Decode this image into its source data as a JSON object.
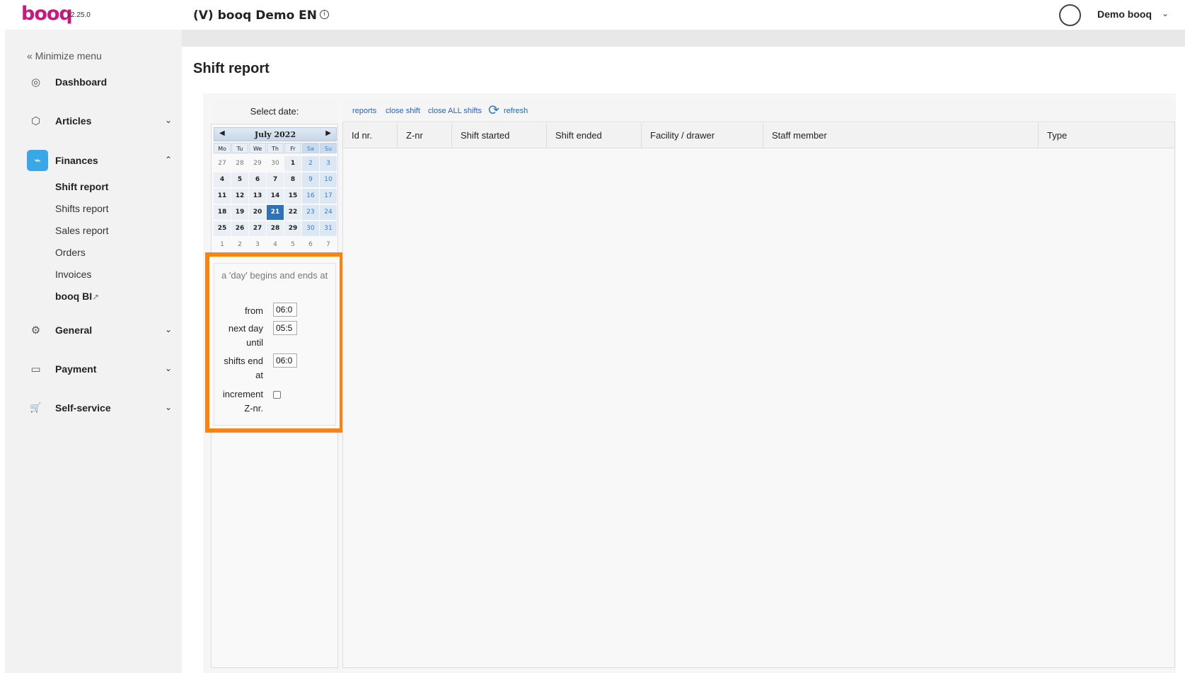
{
  "header": {
    "logo": "booq",
    "version": "v2.25.0",
    "app_title": "(V) booq Demo EN",
    "info_icon": "i",
    "user_name": "Demo booq",
    "user_chevron": "⌄"
  },
  "sidebar": {
    "minimize_label": "« Minimize menu",
    "items": [
      {
        "label": "Dashboard",
        "icon": "compass-icon",
        "glyph": "◎",
        "chevron": ""
      },
      {
        "label": "Articles",
        "icon": "box-icon",
        "glyph": "⬡",
        "chevron": "⌄"
      },
      {
        "label": "Finances",
        "icon": "pulse-icon",
        "glyph": "⌁",
        "chevron": "⌃"
      },
      {
        "label": "General",
        "icon": "gear-icon",
        "glyph": "⚙",
        "chevron": "⌄"
      },
      {
        "label": "Payment",
        "icon": "card-icon",
        "glyph": "▭",
        "chevron": "⌄"
      },
      {
        "label": "Self-service",
        "icon": "cart-icon",
        "glyph": "🛒",
        "chevron": "⌄"
      }
    ],
    "finances_sub": [
      "Shift report",
      "Shifts report",
      "Sales report",
      "Orders",
      "Invoices",
      "booq BI"
    ],
    "external_link_icon": "↗"
  },
  "page": {
    "title": "Shift report"
  },
  "calendar": {
    "select_label": "Select date:",
    "month": "July 2022",
    "prev": "◀",
    "next": "▶",
    "weekdays": [
      "Mo",
      "Tu",
      "We",
      "Th",
      "Fr",
      "Sa",
      "Su"
    ],
    "weeks": [
      [
        "27",
        "28",
        "29",
        "30",
        "1",
        "2",
        "3"
      ],
      [
        "4",
        "5",
        "6",
        "7",
        "8",
        "9",
        "10"
      ],
      [
        "11",
        "12",
        "13",
        "14",
        "15",
        "16",
        "17"
      ],
      [
        "18",
        "19",
        "20",
        "21",
        "22",
        "23",
        "24"
      ],
      [
        "25",
        "26",
        "27",
        "28",
        "29",
        "30",
        "31"
      ],
      [
        "1",
        "2",
        "3",
        "4",
        "5",
        "6",
        "7"
      ]
    ],
    "selected": "21"
  },
  "day_settings": {
    "title": "a 'day' begins and ends at",
    "from_label": "from",
    "from_value": "06:0",
    "next_day_label": "next day until",
    "next_day_value": "05:5",
    "shifts_end_label": "shifts end at",
    "shifts_end_value": "06:0",
    "increment_label": "increment Z-nr.",
    "increment_checked": false
  },
  "toolbar": {
    "reports": "reports",
    "close_shift": "close shift",
    "close_all": "close ALL shifts",
    "refresh_icon": "⟳",
    "refresh": "refresh"
  },
  "table": {
    "columns": [
      "Id nr.",
      "Z-nr",
      "Shift started",
      "Shift ended",
      "Facility / drawer",
      "Staff member",
      "Type"
    ]
  },
  "colors": {
    "brand": "#c9177e",
    "accent": "#3aa7e6",
    "highlight_border": "#f7850f",
    "link": "#2266bb"
  }
}
